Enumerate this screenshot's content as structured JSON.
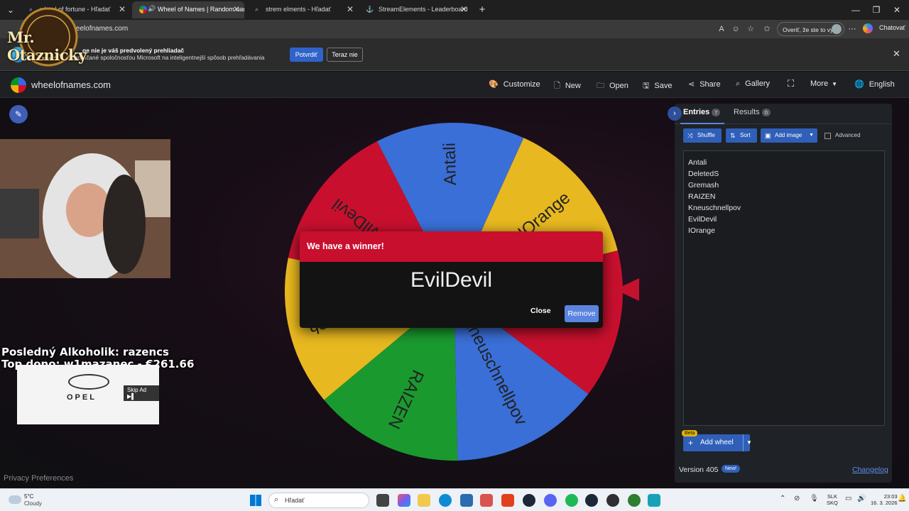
{
  "browser": {
    "tabs": [
      {
        "title": "wheel of fortune - Hľadať",
        "active": false
      },
      {
        "title": "Wheel of Names | Random name picker",
        "active": true
      },
      {
        "title": "strem elments - Hľadať",
        "active": false
      },
      {
        "title": "StreamElements - Leaderboard",
        "active": false
      }
    ],
    "url": "wheelofnames.com",
    "verify_label": "Overiť, že ste to vy",
    "copilot_label": "Chatovať"
  },
  "infobar": {
    "title": "ge nie je váš predvolený prehliadač",
    "subtitle": "venia odporúčané spoločnosťou Microsoft na inteligentnejší spôsob prehľadávania",
    "confirm_label": "Potvrdiť",
    "notnow_label": "Teraz nie"
  },
  "site": {
    "name": "wheelofnames.com",
    "nav": [
      {
        "label": "Customize",
        "icon": "palette-icon"
      },
      {
        "label": "New",
        "icon": "file-icon"
      },
      {
        "label": "Open",
        "icon": "folder-icon"
      },
      {
        "label": "Save",
        "icon": "save-icon"
      },
      {
        "label": "Share",
        "icon": "share-icon"
      },
      {
        "label": "Gallery",
        "icon": "search-icon"
      },
      {
        "label": "",
        "icon": "fullscreen-icon"
      },
      {
        "label": "More",
        "icon": "chevron-down-icon"
      },
      {
        "label": "English",
        "icon": "globe-icon"
      }
    ]
  },
  "wheel": {
    "segments": [
      {
        "label": "Antali",
        "color": "#3a6fd8"
      },
      {
        "label": "IOrange",
        "color": "#e8b820"
      },
      {
        "label": "DeletedS",
        "color": "#c8102e"
      },
      {
        "label": "Kneuschnellpov",
        "color": "#3a6fd8"
      },
      {
        "label": "RAIZEN",
        "color": "#1a9a2e"
      },
      {
        "label": "Gremash",
        "color": "#e8b820"
      },
      {
        "label": "EvilDevil",
        "color": "#c8102e"
      }
    ]
  },
  "panel": {
    "tab_entries": "Entries",
    "entries_count": "7",
    "tab_results": "Results",
    "results_count": "0",
    "shuffle_label": "Shuffle",
    "sort_label": "Sort",
    "add_image_label": "Add image",
    "advanced_label": "Advanced",
    "entries": [
      "Antali",
      "DeletedS",
      "Gremash",
      "RAIZEN",
      "Kneuschnellpov",
      "EvilDevil",
      "IOrange"
    ],
    "beta_label": "Beta",
    "add_wheel_label": "Add wheel",
    "version": "Version 405",
    "new_label": "New!",
    "changelog_label": "Changelog"
  },
  "dialog": {
    "title": "We have a winner!",
    "winner": "EvilDevil",
    "close_label": "Close",
    "remove_label": "Remove"
  },
  "overlay": {
    "stream_name": "Mr. Otaznicky",
    "line1": "Posledný Alkoholik: razencs",
    "line2": " Top dono: w1mazanec - €261.66",
    "ad_brand": "OPEL",
    "skip_ad": "Skip Ad ▶▌",
    "privacy": "Privacy Preferences"
  },
  "taskbar": {
    "temperature": "5°C",
    "condition": "Cloudy",
    "search_placeholder": "Hľadať",
    "lang_top": "SLK",
    "lang_bottom": "SKQ",
    "time": "23:03",
    "date": "16. 3. 2026"
  }
}
